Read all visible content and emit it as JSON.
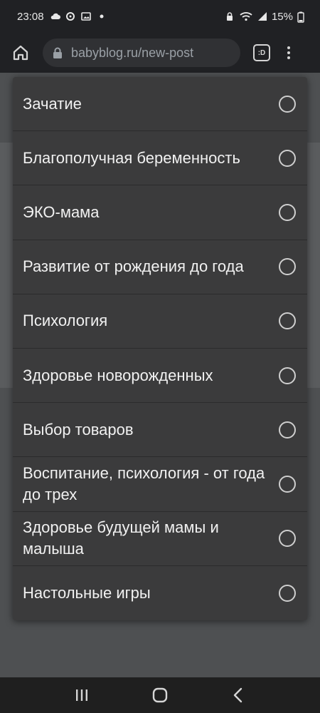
{
  "status_bar": {
    "time": "23:08",
    "battery": "15%"
  },
  "browser": {
    "url": "babyblog.ru/new-post",
    "tab_switch_label": ":D"
  },
  "dialog": {
    "options": [
      {
        "label": "Зачатие",
        "selected": false
      },
      {
        "label": "Благополучная беременность",
        "selected": false
      },
      {
        "label": "ЭКО-мама",
        "selected": false
      },
      {
        "label": "Развитие от рождения до года",
        "selected": false
      },
      {
        "label": "Психология",
        "selected": false
      },
      {
        "label": "Здоровье новорожденных",
        "selected": false
      },
      {
        "label": "Выбор товаров",
        "selected": false
      },
      {
        "label": "Воспитание, психология - от года до трех",
        "selected": false
      },
      {
        "label": "Здоровье будущей мамы и малыша",
        "selected": false
      },
      {
        "label": "Настольные игры",
        "selected": false
      }
    ]
  },
  "icons": {
    "home": "home-icon",
    "lock": "lock-icon",
    "menu": "more-vert-icon",
    "recents": "recents-icon",
    "home_nav": "home-nav-icon",
    "back": "back-icon"
  }
}
